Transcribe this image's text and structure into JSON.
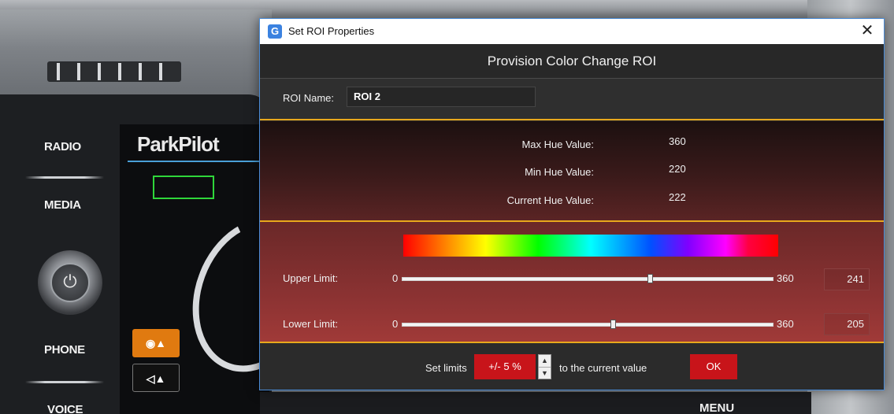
{
  "background": {
    "side_buttons": [
      "RADIO",
      "MEDIA",
      "PHONE",
      "VOICE"
    ],
    "screen_title": "ParkPilot",
    "menu_label": "MENU"
  },
  "dialog": {
    "title": "Set ROI Properties",
    "close_glyph": "✕",
    "header": "Provision Color Change ROI",
    "roi_name_label": "ROI Name:",
    "roi_name_value": "ROI 2",
    "hue": {
      "max_label": "Max Hue Value:",
      "max_value": "360",
      "min_label": "Min Hue Value:",
      "min_value": "220",
      "current_label": "Current Hue Value:",
      "current_value": "222"
    },
    "upper": {
      "label": "Upper Limit:",
      "min": "0",
      "max": "360",
      "value": "241",
      "level": 241
    },
    "lower": {
      "label": "Lower Limit:",
      "min": "0",
      "max": "360",
      "value": "205",
      "level": 205
    },
    "footer": {
      "set_limits": "Set limits",
      "percent": "+/-  5 %",
      "suffix": "to the current value",
      "ok": "OK"
    }
  },
  "colors": {
    "accent": "#e8a81c",
    "button_red": "#c8141a",
    "roi_box": "#2fd63a"
  }
}
